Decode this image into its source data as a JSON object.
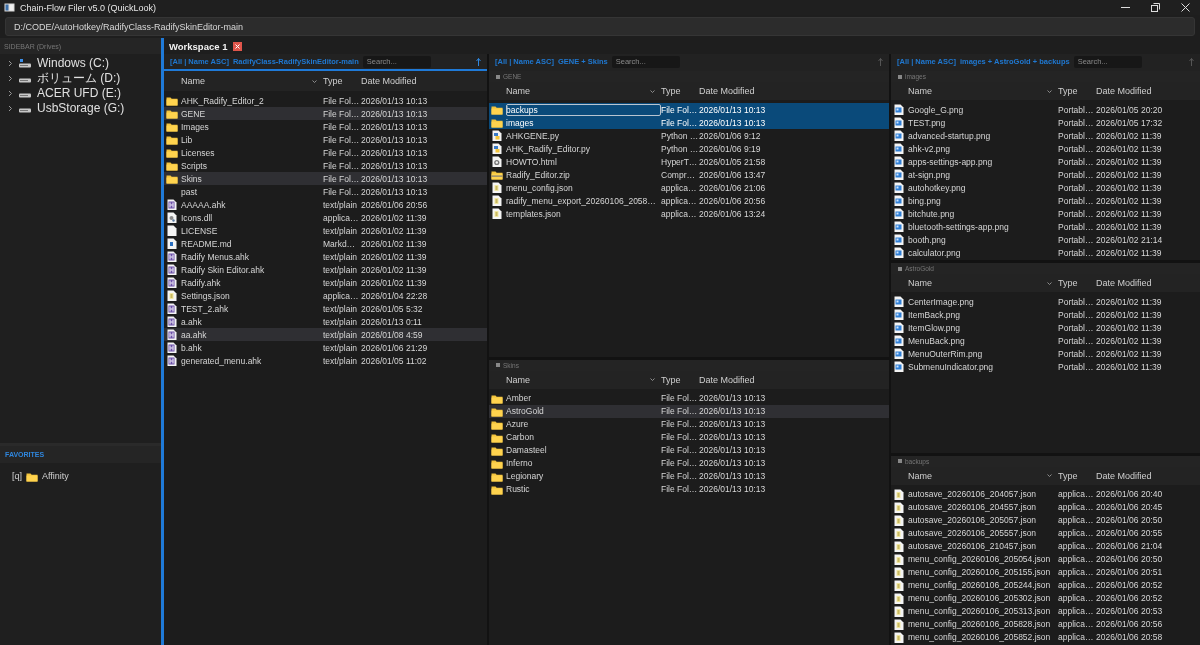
{
  "window": {
    "title": "Chain-Flow Filer v5.0 (QuickLook)"
  },
  "address_bar": {
    "value": "D:/CODE/AutoHotkey/RadifyClass-RadifySkinEditor-main"
  },
  "sidebar": {
    "heading": "SIDEBAR (Drives)",
    "drives": [
      {
        "label": "Windows (C:)",
        "kind": "system"
      },
      {
        "label": "ボリューム (D:)",
        "kind": "drive"
      },
      {
        "label": "ACER UFD (E:)",
        "kind": "drive"
      },
      {
        "label": "UsbStorage (G:)",
        "kind": "drive"
      }
    ],
    "favorites_heading": "FAVORITES",
    "favorites": [
      {
        "key": "[q]",
        "label": "Affinity"
      }
    ]
  },
  "workspace": {
    "title": "Workspace 1",
    "columns": [
      {
        "active": true,
        "filter": "[All | Name ASC]",
        "path": "RadifyClass-RadifySkinEditor-main",
        "search_placeholder": "Search...",
        "panes": [
          {
            "headers": [
              "Name",
              "Type",
              "Date Modified"
            ],
            "rows": [
              {
                "name": "AHK_Radify_Editor_2",
                "type": "File Fol…",
                "date": "2026/01/13 10:13",
                "kind": "folder",
                "selected": false,
                "highlighted": false
              },
              {
                "name": "GENE",
                "type": "File Fol…",
                "date": "2026/01/13 10:13",
                "kind": "folder",
                "selected": false,
                "highlighted": true
              },
              {
                "name": "Images",
                "type": "File Fol…",
                "date": "2026/01/13 10:13",
                "kind": "folder",
                "selected": false,
                "highlighted": false
              },
              {
                "name": "Lib",
                "type": "File Fol…",
                "date": "2026/01/13 10:13",
                "kind": "folder",
                "selected": false,
                "highlighted": false
              },
              {
                "name": "Licenses",
                "type": "File Fol…",
                "date": "2026/01/13 10:13",
                "kind": "folder",
                "selected": false,
                "highlighted": false
              },
              {
                "name": "Scripts",
                "type": "File Fol…",
                "date": "2026/01/13 10:13",
                "kind": "folder",
                "selected": false,
                "highlighted": false
              },
              {
                "name": "Skins",
                "type": "File Fol…",
                "date": "2026/01/13 10:13",
                "kind": "folder",
                "selected": false,
                "highlighted": true
              },
              {
                "name": "past",
                "type": "File Fol…",
                "date": "2026/01/13 10:13",
                "kind": "none",
                "selected": false,
                "highlighted": false
              },
              {
                "name": "AAAAA.ahk",
                "type": "text/plain",
                "date": "2026/01/06 20:56",
                "kind": "ahk",
                "selected": false,
                "highlighted": false
              },
              {
                "name": "Icons.dll",
                "type": "applica…",
                "date": "2026/01/02 11:39",
                "kind": "dll",
                "selected": false,
                "highlighted": false
              },
              {
                "name": "LICENSE",
                "type": "text/plain",
                "date": "2026/01/02 11:39",
                "kind": "file",
                "selected": false,
                "highlighted": false
              },
              {
                "name": "README.md",
                "type": "Markd…",
                "date": "2026/01/02 11:39",
                "kind": "md",
                "selected": false,
                "highlighted": false
              },
              {
                "name": "Radify Menus.ahk",
                "type": "text/plain",
                "date": "2026/01/02 11:39",
                "kind": "ahk",
                "selected": false,
                "highlighted": false
              },
              {
                "name": "Radify Skin Editor.ahk",
                "type": "text/plain",
                "date": "2026/01/02 11:39",
                "kind": "ahk",
                "selected": false,
                "highlighted": false
              },
              {
                "name": "Radify.ahk",
                "type": "text/plain",
                "date": "2026/01/02 11:39",
                "kind": "ahk",
                "selected": false,
                "highlighted": false
              },
              {
                "name": "Settings.json",
                "type": "applica…",
                "date": "2026/01/04 22:28",
                "kind": "json",
                "selected": false,
                "highlighted": false
              },
              {
                "name": "TEST_2.ahk",
                "type": "text/plain",
                "date": "2026/01/05 5:32",
                "kind": "ahk",
                "selected": false,
                "highlighted": false
              },
              {
                "name": "a.ahk",
                "type": "text/plain",
                "date": "2026/01/13 0:11",
                "kind": "ahk",
                "selected": false,
                "highlighted": false
              },
              {
                "name": "aa.ahk",
                "type": "text/plain",
                "date": "2026/01/08 4:59",
                "kind": "ahk",
                "selected": false,
                "highlighted": true
              },
              {
                "name": "b.ahk",
                "type": "text/plain",
                "date": "2026/01/06 21:29",
                "kind": "ahk",
                "selected": false,
                "highlighted": false
              },
              {
                "name": "generated_menu.ahk",
                "type": "text/plain",
                "date": "2026/01/05 11:02",
                "kind": "ahk",
                "selected": false,
                "highlighted": false
              }
            ]
          }
        ]
      },
      {
        "active": false,
        "filter": "[All | Name ASC]",
        "path": "GENE + Skins",
        "search_placeholder": "Search...",
        "panes": [
          {
            "label": "GENE",
            "headers": [
              "Name",
              "Type",
              "Date Modified"
            ],
            "rows": [
              {
                "name": "backups",
                "type": "File Fol…",
                "date": "2026/01/13 10:13",
                "kind": "folder",
                "selected": true,
                "highlighted": false,
                "focused": true
              },
              {
                "name": "images",
                "type": "File Fol…",
                "date": "2026/01/13 10:13",
                "kind": "folder",
                "selected": true,
                "highlighted": false,
                "focused": false
              },
              {
                "name": "AHKGENE.py",
                "type": "Python …",
                "date": "2026/01/06 9:12",
                "kind": "python",
                "selected": false,
                "highlighted": false,
                "focused": false
              },
              {
                "name": "AHK_Radify_Editor.py",
                "type": "Python …",
                "date": "2026/01/06 9:19",
                "kind": "python",
                "selected": false,
                "highlighted": false,
                "focused": false
              },
              {
                "name": "HOWTO.html",
                "type": "HyperT…",
                "date": "2026/01/05 21:58",
                "kind": "html",
                "selected": false,
                "highlighted": false,
                "focused": false
              },
              {
                "name": "Radify_Editor.zip",
                "type": "Compr…",
                "date": "2026/01/06 13:47",
                "kind": "zip",
                "selected": false,
                "highlighted": false,
                "focused": false
              },
              {
                "name": "menu_config.json",
                "type": "applica…",
                "date": "2026/01/06 21:06",
                "kind": "json",
                "selected": false,
                "highlighted": false,
                "focused": false
              },
              {
                "name": "radify_menu_export_20260106_2058…",
                "type": "applica…",
                "date": "2026/01/06 20:56",
                "kind": "json",
                "selected": false,
                "highlighted": false,
                "focused": false
              },
              {
                "name": "templates.json",
                "type": "applica…",
                "date": "2026/01/06 13:24",
                "kind": "json",
                "selected": false,
                "highlighted": false,
                "focused": false
              }
            ]
          },
          {
            "label": "Skins",
            "headers": [
              "Name",
              "Type",
              "Date Modified"
            ],
            "rows": [
              {
                "name": "Amber",
                "type": "File Fol…",
                "date": "2026/01/13 10:13",
                "kind": "folder",
                "selected": false,
                "highlighted": false
              },
              {
                "name": "AstroGold",
                "type": "File Fol…",
                "date": "2026/01/13 10:13",
                "kind": "folder",
                "selected": false,
                "highlighted": true
              },
              {
                "name": "Azure",
                "type": "File Fol…",
                "date": "2026/01/13 10:13",
                "kind": "folder",
                "selected": false,
                "highlighted": false
              },
              {
                "name": "Carbon",
                "type": "File Fol…",
                "date": "2026/01/13 10:13",
                "kind": "folder",
                "selected": false,
                "highlighted": false
              },
              {
                "name": "Damasteel",
                "type": "File Fol…",
                "date": "2026/01/13 10:13",
                "kind": "folder",
                "selected": false,
                "highlighted": false
              },
              {
                "name": "Inferno",
                "type": "File Fol…",
                "date": "2026/01/13 10:13",
                "kind": "folder",
                "selected": false,
                "highlighted": false
              },
              {
                "name": "Legionary",
                "type": "File Fol…",
                "date": "2026/01/13 10:13",
                "kind": "folder",
                "selected": false,
                "highlighted": false
              },
              {
                "name": "Rustic",
                "type": "File Fol…",
                "date": "2026/01/13 10:13",
                "kind": "folder",
                "selected": false,
                "highlighted": false
              }
            ]
          }
        ]
      },
      {
        "active": false,
        "filter": "[All | Name ASC]",
        "path": "images + AstroGold + backups",
        "search_placeholder": "Search...",
        "panes": [
          {
            "label": "images",
            "headers": [
              "Name",
              "Type",
              "Date Modified"
            ],
            "rows": [
              {
                "name": "Google_G.png",
                "type": "Portabl…",
                "date": "2026/01/05 20:20",
                "kind": "png",
                "selected": false,
                "highlighted": false
              },
              {
                "name": "TEST.png",
                "type": "Portabl…",
                "date": "2026/01/05 17:32",
                "kind": "png",
                "selected": false,
                "highlighted": false
              },
              {
                "name": "advanced-startup.png",
                "type": "Portabl…",
                "date": "2026/01/02 11:39",
                "kind": "png",
                "selected": false,
                "highlighted": false
              },
              {
                "name": "ahk-v2.png",
                "type": "Portabl…",
                "date": "2026/01/02 11:39",
                "kind": "png",
                "selected": false,
                "highlighted": false
              },
              {
                "name": "apps-settings-app.png",
                "type": "Portabl…",
                "date": "2026/01/02 11:39",
                "kind": "png",
                "selected": false,
                "highlighted": false
              },
              {
                "name": "at-sign.png",
                "type": "Portabl…",
                "date": "2026/01/02 11:39",
                "kind": "png",
                "selected": false,
                "highlighted": false
              },
              {
                "name": "autohotkey.png",
                "type": "Portabl…",
                "date": "2026/01/02 11:39",
                "kind": "png",
                "selected": false,
                "highlighted": false
              },
              {
                "name": "bing.png",
                "type": "Portabl…",
                "date": "2026/01/02 11:39",
                "kind": "png",
                "selected": false,
                "highlighted": false
              },
              {
                "name": "bitchute.png",
                "type": "Portabl…",
                "date": "2026/01/02 11:39",
                "kind": "png",
                "selected": false,
                "highlighted": false
              },
              {
                "name": "bluetooth-settings-app.png",
                "type": "Portabl…",
                "date": "2026/01/02 11:39",
                "kind": "png",
                "selected": false,
                "highlighted": false
              },
              {
                "name": "booth.png",
                "type": "Portabl…",
                "date": "2026/01/02 21:14",
                "kind": "png",
                "selected": false,
                "highlighted": false
              },
              {
                "name": "calculator.png",
                "type": "Portabl…",
                "date": "2026/01/02 11:39",
                "kind": "png",
                "selected": false,
                "highlighted": false
              }
            ]
          },
          {
            "label": "AstroGold",
            "headers": [
              "Name",
              "Type",
              "Date Modified"
            ],
            "rows": [
              {
                "name": "CenterImage.png",
                "type": "Portabl…",
                "date": "2026/01/02 11:39",
                "kind": "png",
                "selected": false,
                "highlighted": false
              },
              {
                "name": "ItemBack.png",
                "type": "Portabl…",
                "date": "2026/01/02 11:39",
                "kind": "png",
                "selected": false,
                "highlighted": false
              },
              {
                "name": "ItemGlow.png",
                "type": "Portabl…",
                "date": "2026/01/02 11:39",
                "kind": "png",
                "selected": false,
                "highlighted": false
              },
              {
                "name": "MenuBack.png",
                "type": "Portabl…",
                "date": "2026/01/02 11:39",
                "kind": "png",
                "selected": false,
                "highlighted": false
              },
              {
                "name": "MenuOuterRim.png",
                "type": "Portabl…",
                "date": "2026/01/02 11:39",
                "kind": "png",
                "selected": false,
                "highlighted": false
              },
              {
                "name": "SubmenuIndicator.png",
                "type": "Portabl…",
                "date": "2026/01/02 11:39",
                "kind": "png",
                "selected": false,
                "highlighted": false
              }
            ]
          },
          {
            "label": "backups",
            "headers": [
              "Name",
              "Type",
              "Date Modified"
            ],
            "rows": [
              {
                "name": "autosave_20260106_204057.json",
                "type": "applica…",
                "date": "2026/01/06 20:40",
                "kind": "json",
                "selected": false,
                "highlighted": false
              },
              {
                "name": "autosave_20260106_204557.json",
                "type": "applica…",
                "date": "2026/01/06 20:45",
                "kind": "json",
                "selected": false,
                "highlighted": false
              },
              {
                "name": "autosave_20260106_205057.json",
                "type": "applica…",
                "date": "2026/01/06 20:50",
                "kind": "json",
                "selected": false,
                "highlighted": false
              },
              {
                "name": "autosave_20260106_205557.json",
                "type": "applica…",
                "date": "2026/01/06 20:55",
                "kind": "json",
                "selected": false,
                "highlighted": false
              },
              {
                "name": "autosave_20260106_210457.json",
                "type": "applica…",
                "date": "2026/01/06 21:04",
                "kind": "json",
                "selected": false,
                "highlighted": false
              },
              {
                "name": "menu_config_20260106_205054.json",
                "type": "applica…",
                "date": "2026/01/06 20:50",
                "kind": "json",
                "selected": false,
                "highlighted": false
              },
              {
                "name": "menu_config_20260106_205155.json",
                "type": "applica…",
                "date": "2026/01/06 20:51",
                "kind": "json",
                "selected": false,
                "highlighted": false
              },
              {
                "name": "menu_config_20260106_205244.json",
                "type": "applica…",
                "date": "2026/01/06 20:52",
                "kind": "json",
                "selected": false,
                "highlighted": false
              },
              {
                "name": "menu_config_20260106_205302.json",
                "type": "applica…",
                "date": "2026/01/06 20:52",
                "kind": "json",
                "selected": false,
                "highlighted": false
              },
              {
                "name": "menu_config_20260106_205313.json",
                "type": "applica…",
                "date": "2026/01/06 20:53",
                "kind": "json",
                "selected": false,
                "highlighted": false
              },
              {
                "name": "menu_config_20260106_205828.json",
                "type": "applica…",
                "date": "2026/01/06 20:56",
                "kind": "json",
                "selected": false,
                "highlighted": false
              },
              {
                "name": "menu_config_20260106_205852.json",
                "type": "applica…",
                "date": "2026/01/06 20:58",
                "kind": "json",
                "selected": false,
                "highlighted": false
              }
            ]
          }
        ]
      }
    ]
  }
}
